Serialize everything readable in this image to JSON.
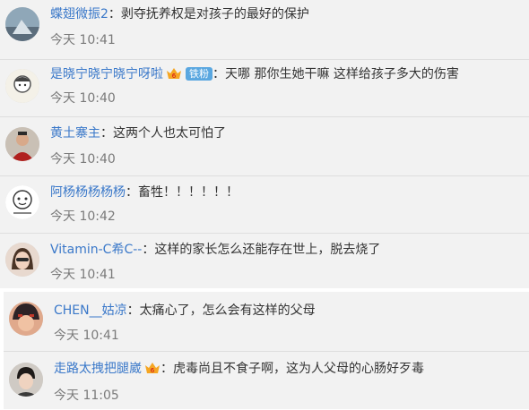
{
  "comments": [
    {
      "username": "蝶翅微振2",
      "text": "剥夺抚养权是对孩子的最好的保护",
      "time": "今天 10:41"
    },
    {
      "username": "是晓宁晓宁晓宁呀啦",
      "fan_badge": "铁粉",
      "text": "天哪 那你生她干嘛 这样给孩子多大的伤害",
      "time": "今天 10:40"
    },
    {
      "username": "黄土寨主",
      "text": "这两个人也太可怕了",
      "time": "今天 10:40"
    },
    {
      "username": "阿杨杨杨杨杨",
      "text": "畜牲！！！！！！",
      "time": "今天 10:42"
    },
    {
      "username": "Vitamin-C希C--",
      "text": "这样的家长怎么还能存在世上，脱去烧了",
      "time": "今天 10:41"
    },
    {
      "username": "CHEN__姑凉",
      "text": "太痛心了，怎么会有这样的父母",
      "time": "今天 10:41"
    },
    {
      "username": "走路太拽把腿崴",
      "text": "虎毒尚且不食子啊，这为人父母的心肠好歹毒",
      "time": "今天 11:05"
    }
  ],
  "separator": "：",
  "colors": {
    "username": "#3a78c9",
    "text": "#333333",
    "time": "#7a7a7a",
    "panel": "#f2f2f2",
    "fan_badge": "#5aa7e0"
  },
  "icons": {
    "vip": "vip-crown-icon"
  }
}
